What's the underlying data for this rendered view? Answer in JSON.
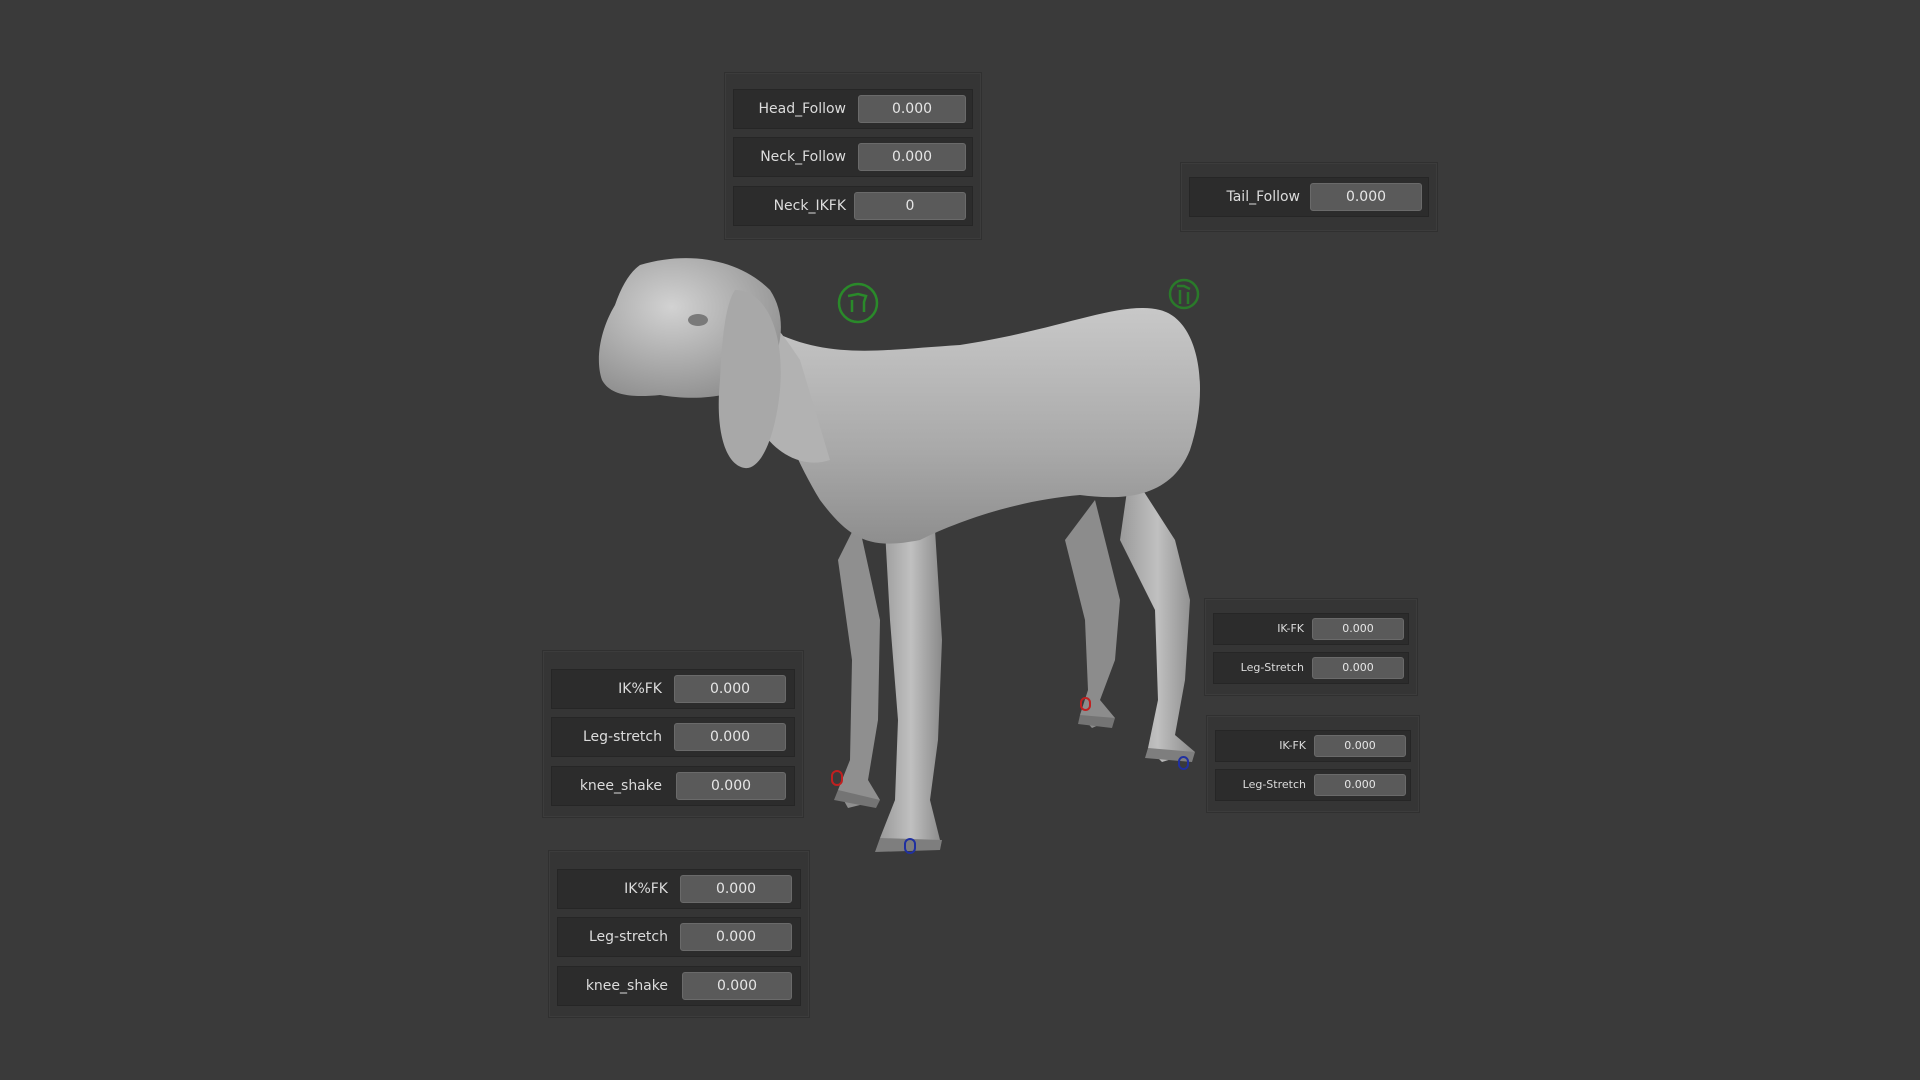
{
  "viewport": {
    "background": "#3a3a3a",
    "model_color": "#b4b4b4",
    "control_colors": {
      "head": "#2a8a2a",
      "tail": "#2a7a2a",
      "ik": "#c02020",
      "fk": "#2030a0"
    }
  },
  "head_panel": {
    "rows": [
      {
        "label": "Head_Follow",
        "value": "0.000"
      },
      {
        "label": "Neck_Follow",
        "value": "0.000"
      },
      {
        "label": "Neck_IKFK",
        "value": "0"
      }
    ]
  },
  "tail_panel": {
    "rows": [
      {
        "label": "Tail_Follow",
        "value": "0.000"
      }
    ]
  },
  "front_leg_panel_1": {
    "rows": [
      {
        "label": "IK%FK",
        "value": "0.000"
      },
      {
        "label": "Leg-stretch",
        "value": "0.000"
      },
      {
        "label": "knee_shake",
        "value": "0.000"
      }
    ]
  },
  "front_leg_panel_2": {
    "rows": [
      {
        "label": "IK%FK",
        "value": "0.000"
      },
      {
        "label": "Leg-stretch",
        "value": "0.000"
      },
      {
        "label": "knee_shake",
        "value": "0.000"
      }
    ]
  },
  "hind_leg_panel_1": {
    "rows": [
      {
        "label": "IK-FK",
        "value": "0.000"
      },
      {
        "label": "Leg-Stretch",
        "value": "0.000"
      }
    ]
  },
  "hind_leg_panel_2": {
    "rows": [
      {
        "label": "IK-FK",
        "value": "0.000"
      },
      {
        "label": "Leg-Stretch",
        "value": "0.000"
      }
    ]
  },
  "icons": {
    "head_control": "lamb-head-icon",
    "tail_control": "lamb-tail-icon",
    "ik_handle": "ik-handle-icon",
    "fk_handle": "fk-handle-icon"
  }
}
